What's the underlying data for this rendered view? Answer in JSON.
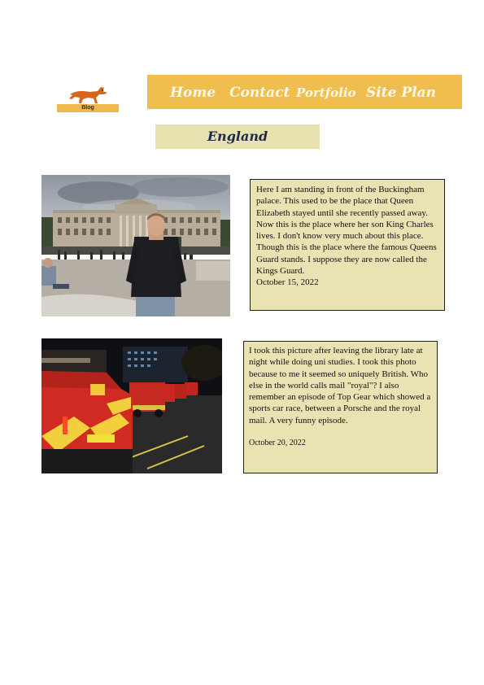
{
  "logo": {
    "label": "Blog"
  },
  "nav": {
    "items": [
      "Home",
      "Contact",
      "Portfolio",
      "Site Plan"
    ]
  },
  "page": {
    "title": "England"
  },
  "posts": [
    {
      "text": "Here I am standing in front of the Buckingham palace. This used to be the place that Queen Elizabeth stayed until she recently passed away. Now this is the place where her son King Charles lives. I don't know very much about this place. Though this is the place where the famous Queens Guard stands. I suppose they are now called the Kings Guard.",
      "date": "October 15, 2022",
      "image_desc": "Man in black jacket standing in front of Buckingham Palace"
    },
    {
      "text": "I took this picture after leaving the library late at night while doing uni studies. I took this photo because to me it seemed so uniquely British. Who else in the world calls mail \"royal\"? I also remember an episode of Top Gear which showed a sports car race, between a Porsche and the royal mail. A very funny episode.",
      "date": "October 20, 2022",
      "image_desc": "Row of red Royal Mail vans parked at night"
    }
  ],
  "colors": {
    "nav_bg": "#f0bd4f",
    "title_bg": "#e8e2b0",
    "card_bg": "#e9e3b3"
  }
}
